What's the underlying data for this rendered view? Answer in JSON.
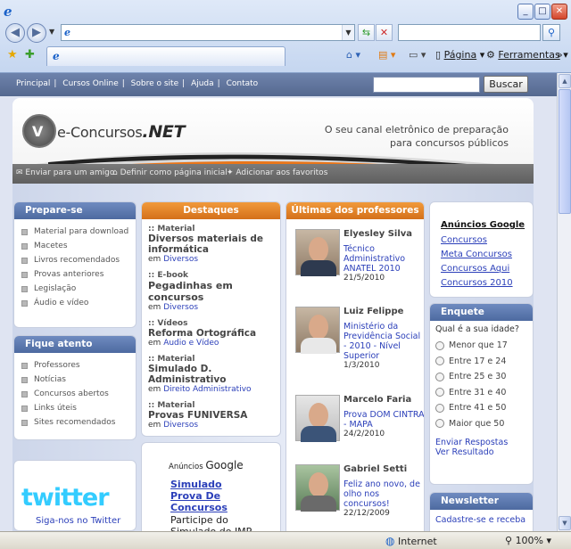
{
  "browser": {
    "address_value": "",
    "search_value": "",
    "toolbar": {
      "page_label": "Página",
      "tools_label": "Ferramentas"
    },
    "status": {
      "zone": "Internet",
      "zoom": "100%"
    }
  },
  "site": {
    "nav": [
      "Principal",
      "Cursos Online",
      "Sobre o site",
      "Ajuda",
      "Contato"
    ],
    "search_button": "Buscar",
    "logo": {
      "main": "e-Concursos",
      "suffix": ".NET"
    },
    "tagline": [
      "O seu canal eletrônico de preparação",
      "para concursos públicos"
    ],
    "banner_links": [
      "Enviar para um amigo",
      "Definir como página inicial",
      "Adicionar aos favoritos"
    ],
    "prepare": {
      "title": "Prepare-se",
      "items": [
        "Material para download",
        "Macetes",
        "Livros recomendados",
        "Provas anteriores",
        "Legislação",
        "Áudio e vídeo"
      ]
    },
    "attentive": {
      "title": "Fique atento",
      "items": [
        "Professores",
        "Notícias",
        "Concursos abertos",
        "Links úteis",
        "Sites recomendados"
      ]
    },
    "twitter": {
      "wordmark": "twitter",
      "follow": "Siga-nos no Twitter"
    },
    "highlights": {
      "title": "Destaques",
      "in_label": "em",
      "items": [
        {
          "category": ":: Material",
          "title": "Diversos materiais de informática",
          "section": "Diversos"
        },
        {
          "category": ":: E-book",
          "title": "Pegadinhas em concursos",
          "section": "Diversos"
        },
        {
          "category": ":: Vídeos",
          "title": "Reforma Ortográfica",
          "section": "Audio e Vídeo"
        },
        {
          "category": ":: Material",
          "title": "Simulado D. Administrativo",
          "section": "Direito Administrativo"
        },
        {
          "category": ":: Material",
          "title": "Provas FUNIVERSA",
          "section": "Diversos"
        }
      ]
    },
    "google_ad": {
      "label": "Anúncios",
      "brand": "Google",
      "link": "Simulado Prova De Concursos",
      "text": "Participe do Simulado do IMP"
    },
    "teachers": {
      "title": "Últimas dos professores",
      "items": [
        {
          "name": "Elyesley Silva",
          "text": "Técnico Administrativo ANATEL 2010",
          "date": "21/5/2010"
        },
        {
          "name": "Luiz Felippe",
          "text": "Ministério da Previdência Social - 2010 - Nível Superior",
          "date": "1/3/2010"
        },
        {
          "name": "Marcelo Faria",
          "text": "Prova DOM CINTRA - MAPA",
          "date": "24/2/2010"
        },
        {
          "name": "Gabriel Setti",
          "text": "Feliz ano novo, de olho nos concursos!",
          "date": "22/12/2009"
        }
      ]
    },
    "ads": {
      "title": "Anúncios Google",
      "links": [
        "Concursos",
        "Meta Concursos",
        "Concursos Aqui",
        "Concursos 2010"
      ]
    },
    "poll": {
      "title": "Enquete",
      "question": "Qual é a sua idade?",
      "options": [
        "Menor que 17",
        "Entre 17 e 24",
        "Entre 25 e 30",
        "Entre 31 e 40",
        "Entre 41 e 50",
        "Maior que 50"
      ],
      "submit": "Enviar Respostas",
      "results": "Ver Resultado"
    },
    "newsletter": {
      "title": "Newsletter",
      "text": "Cadastre-se e receba"
    }
  }
}
